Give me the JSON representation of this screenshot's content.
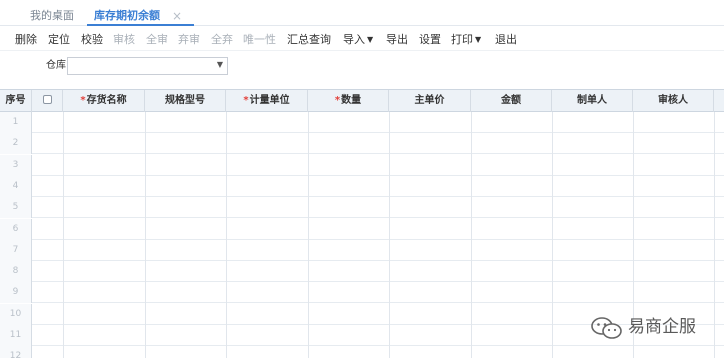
{
  "tabs": [
    {
      "label": "我的桌面",
      "active": false
    },
    {
      "label": "库存期初余额",
      "active": true
    }
  ],
  "tab_close_glyph": "×",
  "toolbar": [
    {
      "label": "删除",
      "enabled": true
    },
    {
      "label": "定位",
      "enabled": true
    },
    {
      "label": "校验",
      "enabled": true
    },
    {
      "label": "审核",
      "enabled": false
    },
    {
      "label": "全审",
      "enabled": false
    },
    {
      "label": "弃审",
      "enabled": false
    },
    {
      "label": "全弃",
      "enabled": false
    },
    {
      "label": "唯一性",
      "enabled": false
    },
    {
      "label": "汇总查询",
      "enabled": true
    },
    {
      "label": "导入",
      "enabled": true,
      "dropdown": true
    },
    {
      "label": "导出",
      "enabled": true
    },
    {
      "label": "设置",
      "enabled": true
    },
    {
      "label": "打印",
      "enabled": true,
      "dropdown": true
    },
    {
      "label": "退出",
      "enabled": true
    }
  ],
  "filter": {
    "label": "仓库",
    "value": ""
  },
  "grid": {
    "columns": [
      {
        "label": "序号",
        "required": false
      },
      {
        "label": "",
        "checkbox": true
      },
      {
        "label": "存货名称",
        "required": true
      },
      {
        "label": "规格型号",
        "required": false
      },
      {
        "label": "计量单位",
        "required": true
      },
      {
        "label": "数量",
        "required": true
      },
      {
        "label": "主单价",
        "required": false
      },
      {
        "label": "金额",
        "required": false
      },
      {
        "label": "制单人",
        "required": false
      },
      {
        "label": "审核人",
        "required": false
      }
    ],
    "row_numbers": [
      "1",
      "2",
      "3",
      "4",
      "5",
      "6",
      "7",
      "8",
      "9",
      "10",
      "11",
      "12"
    ]
  },
  "watermark": {
    "text": "易商企服",
    "icon": "wechat-icon"
  },
  "colors": {
    "accent": "#3b7fd4",
    "required": "#e2403a",
    "header_bg": "#edf2f7",
    "disabled": "#a9b0b8"
  }
}
